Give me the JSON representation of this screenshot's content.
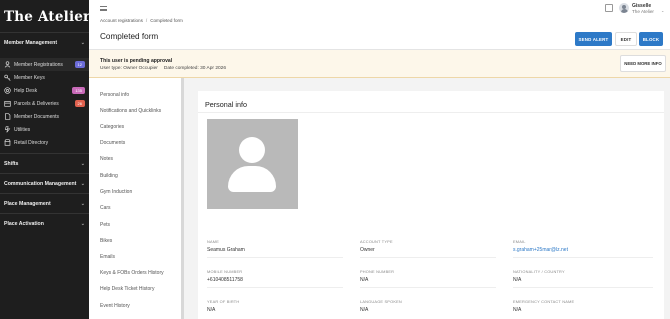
{
  "brand": "The Atelier",
  "sidebar": {
    "sections": [
      {
        "label": "Member Management",
        "chev": "⌄"
      },
      {
        "label": "Shifts",
        "chev": "⌄"
      },
      {
        "label": "Communication Management",
        "chev": "⌄"
      },
      {
        "label": "Place Management",
        "chev": "⌄"
      },
      {
        "label": "Place Activation",
        "chev": "⌄"
      }
    ],
    "items": [
      {
        "label": "Member Registrations",
        "badge": "12",
        "icon": "person-icon"
      },
      {
        "label": "Member Keys",
        "badge": "",
        "icon": "key-icon"
      },
      {
        "label": "Help Desk",
        "badge": "135",
        "icon": "help-icon"
      },
      {
        "label": "Parcels & Deliveries",
        "badge": "26",
        "icon": "parcel-icon"
      },
      {
        "label": "Member Documents",
        "badge": "",
        "icon": "document-icon"
      },
      {
        "label": "Utilities",
        "badge": "",
        "icon": "utilities-icon"
      },
      {
        "label": "Retail Directory",
        "badge": "",
        "icon": "retail-icon"
      }
    ]
  },
  "topbar": {
    "breadcrumb": [
      "Account registrations",
      "Completed form"
    ],
    "breadcrumb_sep": "/",
    "user_name": "Gisselle",
    "user_org": "The Atelier",
    "user_chev": "⌄"
  },
  "page": {
    "title": "Completed form",
    "buttons": {
      "send_alert": "SEND ALERT",
      "edit": "EDIT",
      "block": "BLOCK"
    }
  },
  "notice": {
    "title": "This user is pending approval",
    "user_type": "User type: Owner Occupier",
    "date_completed": "Date completed: 30 Apr 2026",
    "need_more_info": "NEED MORE INFO"
  },
  "subnav": [
    "Personal info",
    "Notifications and Quicklinks",
    "Categories",
    "Documents",
    "Notes",
    "Building",
    "Gym Induction",
    "Cars",
    "Pets",
    "Bikes",
    "Emails",
    "Keys & FOBs Orders History",
    "Help Desk Ticket History",
    "Event History"
  ],
  "personal_info": {
    "title": "Personal info",
    "fields": [
      {
        "label": "NAME",
        "value": "Seamus Graham"
      },
      {
        "label": "ACCOUNT TYPE",
        "value": "Owner"
      },
      {
        "label": "EMAIL",
        "value": "s.graham+25mar@lz.net"
      },
      {
        "label": "MOBILE NUMBER",
        "value": "+610408511758"
      },
      {
        "label": "PHONE NUMBER",
        "value": "N/A"
      },
      {
        "label": "NATIONALITY / COUNTRY",
        "value": "N/A"
      },
      {
        "label": "YEAR OF BIRTH",
        "value": "N/A"
      },
      {
        "label": "LANGUAGE SPOKEN",
        "value": "N/A"
      },
      {
        "label": "EMERGENCY CONTACT NAME",
        "value": "N/A"
      }
    ]
  },
  "colors": {
    "sidebar_bg": "#1e1e1e",
    "accent_blue": "#2d79c7",
    "notice_bg": "#fdf7ea",
    "badge_purple": "#6c6cd8",
    "badge_pink": "#c86ab8",
    "badge_red": "#e0614e"
  }
}
